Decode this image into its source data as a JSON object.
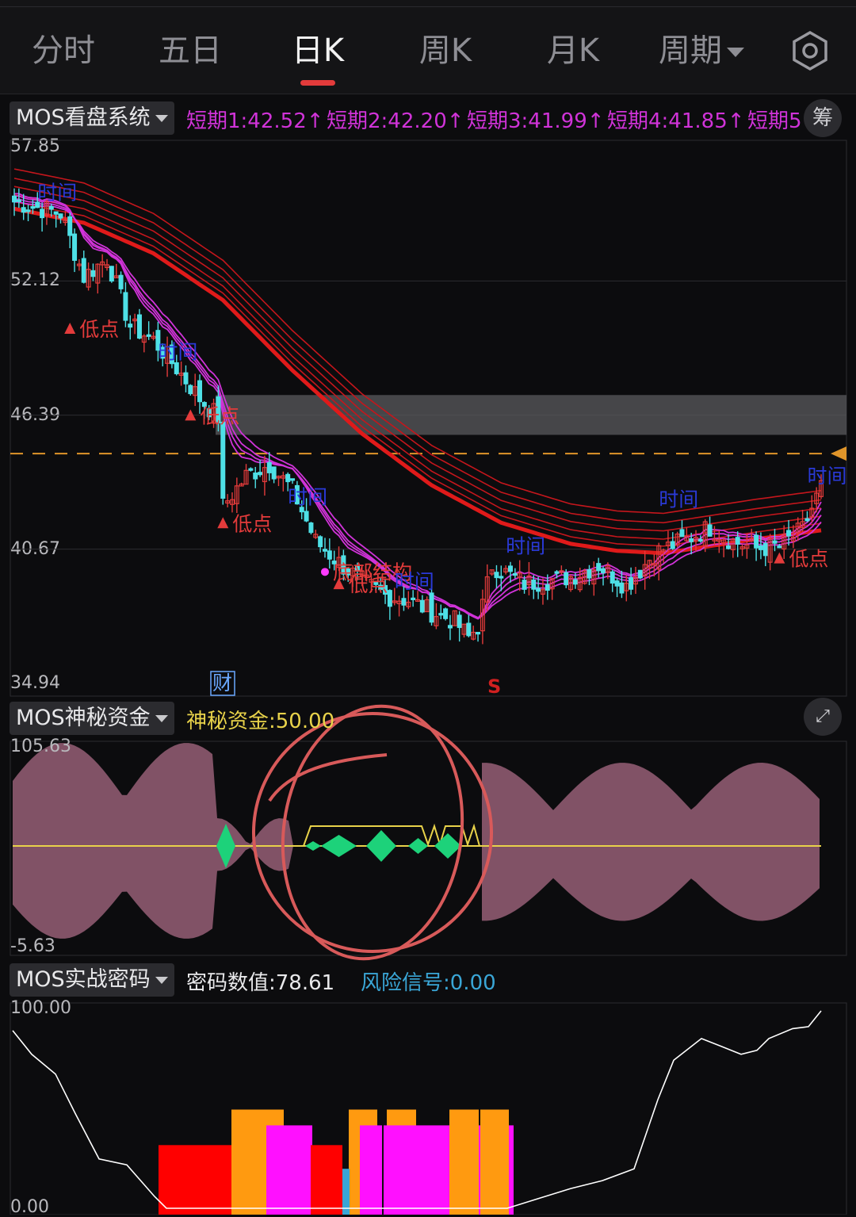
{
  "tabs": [
    "分时",
    "五日",
    "日K",
    "周K",
    "月K",
    "周期"
  ],
  "active_tab": "日K",
  "main_panel": {
    "label": "MOS看盘系统",
    "indicators": [
      {
        "text": "短期1:42.52↑",
        "color": "#d033d8"
      },
      {
        "text": "短期2:42.20↑",
        "color": "#d033d8"
      },
      {
        "text": "短期3:41.99↑",
        "color": "#d033d8"
      },
      {
        "text": "短期4:41.85↑",
        "color": "#d033d8"
      },
      {
        "text": "短期5",
        "color": "#d033d8"
      }
    ],
    "chip_button": "筹",
    "y_ticks": [
      "57.85",
      "52.12",
      "46.39",
      "40.67",
      "34.94"
    ],
    "y_ticks_num": [
      57.85,
      52.12,
      46.39,
      40.67,
      34.94
    ],
    "ref_line_value": 44.75,
    "zone_range": [
      45.55,
      47.25
    ],
    "cai_tag": "财",
    "s_tag": "S",
    "markers": [
      {
        "text": "低点",
        "type": "low",
        "i": 12,
        "v": 50.1
      },
      {
        "text": "低点",
        "type": "low",
        "i": 38,
        "v": 46.4
      },
      {
        "text": "低点",
        "type": "low",
        "i": 45,
        "v": 41.8
      },
      {
        "text": "低点",
        "type": "low",
        "i": 70,
        "v": 39.2
      },
      {
        "text": "低点",
        "type": "low",
        "i": 165,
        "v": 40.3
      },
      {
        "text": "底部结构",
        "type": "struct",
        "i": 67,
        "v": 39.7
      },
      {
        "text": "时间",
        "type": "time",
        "i": 5,
        "v": 55.6
      },
      {
        "text": "时间",
        "type": "time",
        "i": 31,
        "v": 48.8
      },
      {
        "text": "时间",
        "type": "time",
        "i": 59,
        "v": 42.6
      },
      {
        "text": "时间",
        "type": "time",
        "i": 82,
        "v": 39.0
      },
      {
        "text": "时间",
        "type": "time",
        "i": 106,
        "v": 40.5
      },
      {
        "text": "时间",
        "type": "time",
        "i": 139,
        "v": 42.5
      },
      {
        "text": "时间",
        "type": "time",
        "i": 171,
        "v": 43.5
      }
    ]
  },
  "money_panel": {
    "label": "MOS神秘资金",
    "indicator": "神秘资金:50.00",
    "y_top": "105.63",
    "y_bottom": "-5.63",
    "baseline": 50
  },
  "code_panel": {
    "label": "MOS实战密码",
    "indicator_value": "密码数值:78.61",
    "indicator_risk": "风险信号:0.00",
    "y_top": "100.00",
    "y_bottom": "0.00"
  },
  "chart_data": [
    {
      "type": "candlestick",
      "title": "MOS看盘系统",
      "ylim": [
        34.94,
        57.85
      ],
      "n_bars": 175,
      "close_path": [
        [
          0,
          55.5
        ],
        [
          10,
          55.0
        ],
        [
          15,
          52.3
        ],
        [
          20,
          53.1
        ],
        [
          25,
          50.2
        ],
        [
          30,
          49.6
        ],
        [
          35,
          48.4
        ],
        [
          40,
          47.1
        ],
        [
          44,
          46.3
        ],
        [
          45,
          42.5
        ],
        [
          50,
          43.8
        ],
        [
          55,
          44.3
        ],
        [
          60,
          43.2
        ],
        [
          65,
          41.0
        ],
        [
          70,
          40.1
        ],
        [
          75,
          39.3
        ],
        [
          80,
          38.7
        ],
        [
          85,
          38.5
        ],
        [
          90,
          38.0
        ],
        [
          95,
          37.6
        ],
        [
          98,
          36.9
        ],
        [
          100,
          37.4
        ],
        [
          103,
          40.0
        ],
        [
          110,
          39.2
        ],
        [
          120,
          39.5
        ],
        [
          126,
          40.0
        ],
        [
          132,
          39.1
        ],
        [
          138,
          40.5
        ],
        [
          145,
          41.1
        ],
        [
          150,
          41.6
        ],
        [
          155,
          41.0
        ],
        [
          160,
          40.7
        ],
        [
          165,
          40.8
        ],
        [
          170,
          41.5
        ],
        [
          175,
          43.8
        ]
      ],
      "series": [
        {
          "name": "短期1",
          "value": 42.52,
          "color": "#d033d8"
        },
        {
          "name": "短期2",
          "value": 42.2,
          "color": "#d033d8"
        },
        {
          "name": "短期3",
          "value": 41.99,
          "color": "#d033d8"
        },
        {
          "name": "短期4",
          "value": 41.85,
          "color": "#d033d8"
        }
      ],
      "long_ma_path": [
        [
          0,
          55.4
        ],
        [
          15,
          54.8
        ],
        [
          30,
          53.5
        ],
        [
          45,
          51.5
        ],
        [
          60,
          48.5
        ],
        [
          75,
          45.8
        ],
        [
          90,
          43.6
        ],
        [
          105,
          42.0
        ],
        [
          120,
          41.1
        ],
        [
          130,
          40.8
        ],
        [
          140,
          40.7
        ],
        [
          150,
          41.0
        ],
        [
          160,
          41.3
        ],
        [
          175,
          41.7
        ]
      ]
    },
    {
      "type": "area",
      "title": "MOS神秘资金",
      "ylim": [
        -5.63,
        105.63
      ],
      "baseline": 50.0,
      "series": [
        {
          "name": "神秘资金",
          "value": 50.0,
          "color": "#e8d24a"
        }
      ]
    },
    {
      "type": "bar",
      "title": "MOS实战密码",
      "ylim": [
        0.0,
        100.0
      ],
      "series": [
        {
          "name": "密码数值",
          "value": 78.61,
          "color": "#ffffff"
        },
        {
          "name": "风险信号",
          "value": 0.0,
          "color": "#3aa6d6"
        }
      ]
    }
  ],
  "colors": {
    "up": "#e33b3b",
    "down": "#4ee0e6",
    "short_ma": "#d033d8",
    "long_ma": "#e01a1a",
    "money_fill": "#8e5a70",
    "money_green": "#1dd27a",
    "annotation": "#d85a5a"
  }
}
